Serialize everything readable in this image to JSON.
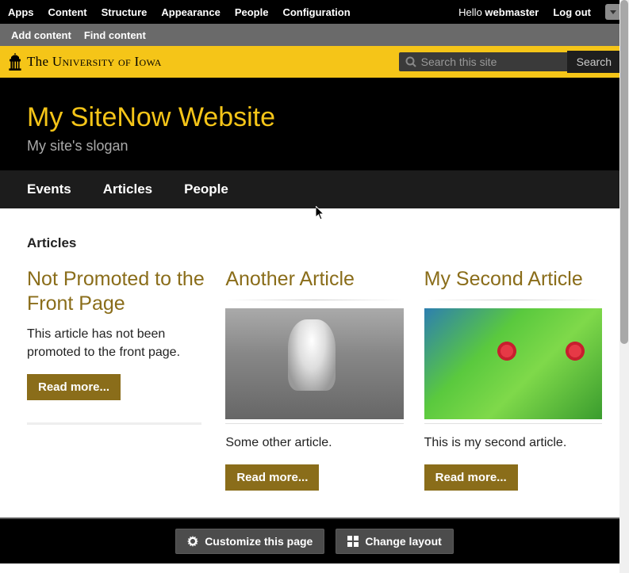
{
  "admin": {
    "menu": [
      "Apps",
      "Content",
      "Structure",
      "Appearance",
      "People",
      "Configuration"
    ],
    "greeting_prefix": "Hello ",
    "username": "webmaster",
    "logout": "Log out"
  },
  "sub_admin": {
    "add_content": "Add content",
    "find_content": "Find content"
  },
  "uni": {
    "name_prefix": "The ",
    "name_main": "University of Iowa"
  },
  "search": {
    "placeholder": "Search this site",
    "button": "Search"
  },
  "site": {
    "title": "My SiteNow Website",
    "slogan": "My site's slogan"
  },
  "nav": {
    "events": "Events",
    "articles": "Articles",
    "people": "People"
  },
  "page": {
    "heading": "Articles"
  },
  "articles": [
    {
      "title": "Not Promoted to the Front Page",
      "summary": "This article has not been promoted to the front page.",
      "read_more": "Read more...",
      "has_image": false
    },
    {
      "title": "Another Article",
      "summary": "Some other article.",
      "read_more": "Read more...",
      "has_image": true
    },
    {
      "title": "My Second Article",
      "summary": "This is my second article.",
      "read_more": "Read more...",
      "has_image": true
    }
  ],
  "bottom": {
    "customize": "Customize this page",
    "change_layout": "Change layout"
  }
}
